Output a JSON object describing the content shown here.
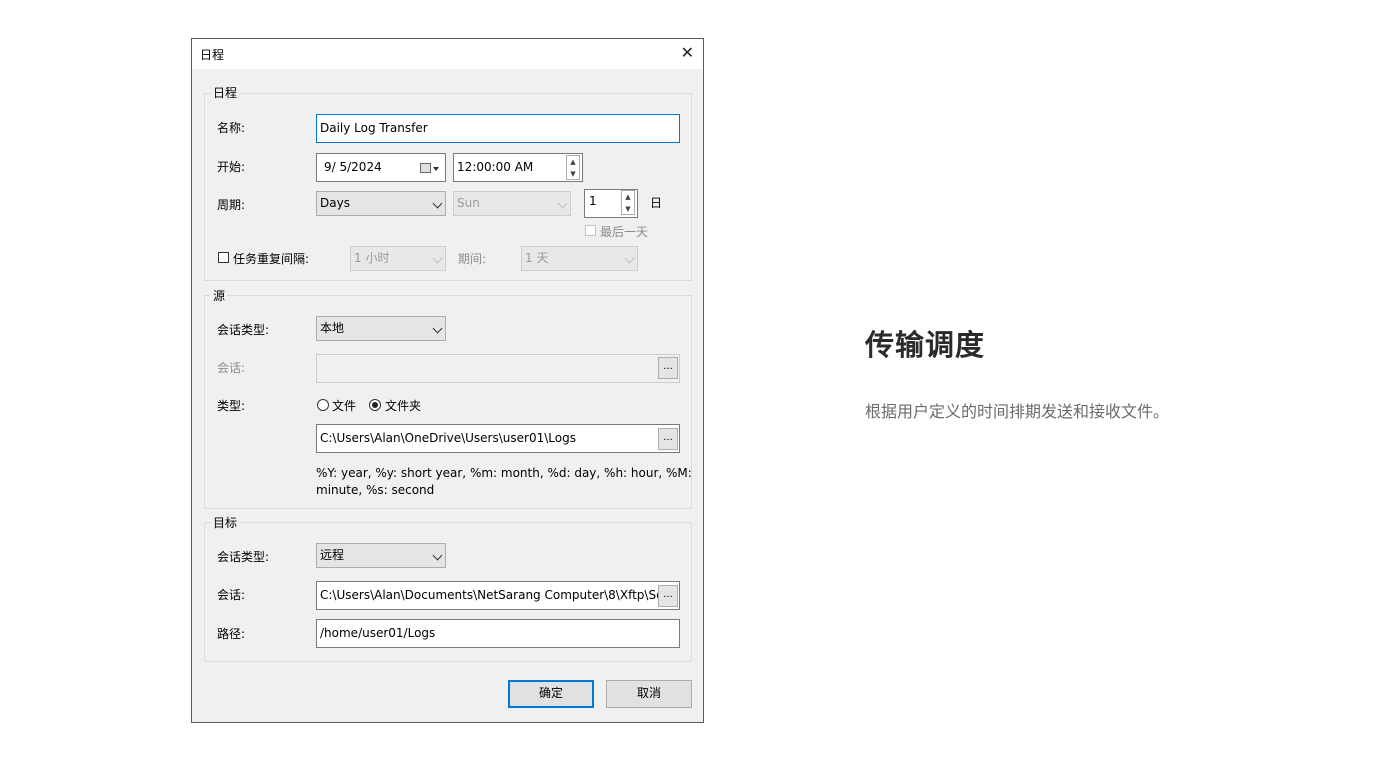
{
  "dialog": {
    "title": "日程",
    "close_glyph": "✕",
    "schedule": {
      "legend": "日程",
      "name_label": "名称:",
      "name_value": "Daily Log Transfer",
      "start_label": "开始:",
      "start_date": "9/  5/2024",
      "start_time": "12:00:00 AM",
      "period_label": "周期:",
      "period_unit": "Days",
      "weekday": "Sun",
      "period_count": "1",
      "day_suffix": "日",
      "last_day_label": "最后一天",
      "repeat_label": "任务重复间隔:",
      "repeat_interval": "1 小时",
      "duration_label": "期间:",
      "duration_value": "1 天"
    },
    "source": {
      "legend": "源",
      "session_type_label": "会话类型:",
      "session_type": "本地",
      "session_label": "会话:",
      "session_value": "",
      "type_label": "类型:",
      "type_file": "文件",
      "type_folder": "文件夹",
      "path_value": "C:\\Users\\Alan\\OneDrive\\Users\\user01\\Logs",
      "hint_line1": "%Y: year, %y: short year, %m: month, %d: day, %h: hour, %M:",
      "hint_line2": "minute, %s: second"
    },
    "target": {
      "legend": "目标",
      "session_type_label": "会话类型:",
      "session_type": "远程",
      "session_label": "会话:",
      "session_value": "C:\\Users\\Alan\\Documents\\NetSarang Computer\\8\\Xftp\\Se",
      "path_label": "路径:",
      "path_value": "/home/user01/Logs"
    },
    "ellipsis_glyph": "...",
    "ok_label": "确定",
    "cancel_label": "取消"
  },
  "promo": {
    "heading": "传输调度",
    "description": "根据用户定义的时间排期发送和接收文件。"
  },
  "colors": {
    "accent": "#0078d7",
    "dialog_bg": "#f0f0f0"
  }
}
